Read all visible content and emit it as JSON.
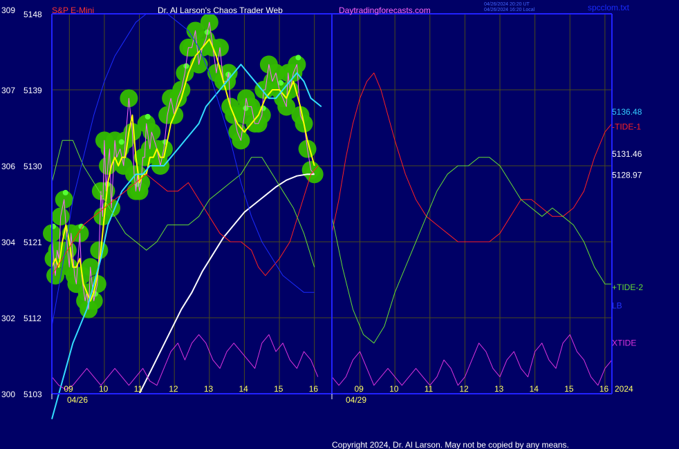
{
  "header": {
    "instrument": "S&P E-Mini",
    "site": "Dr. Al Larson's Chaos Trader Web",
    "url": "Daytradingforecasts.com",
    "utc_stamp": "04/26/2024 20:20 UT",
    "local_stamp": "04/26/2024 16:20 Local",
    "file": "spcclom.txt"
  },
  "footer": {
    "copyright": "Copyright 2024, Dr. Al Larson. May not be copied by any means."
  },
  "colors": {
    "background": "#000066",
    "axis": "#2222ff",
    "grid": "#4a4a1e",
    "price": "#ff66ff",
    "price_avg": "#ffff00",
    "ma": "#33ddff",
    "white_curve": "#ffffff",
    "tide1": "#ff2020",
    "tide2": "#66dd33",
    "lb": "#1a2bff",
    "xtide": "#dd33dd",
    "balls": "#33bb00",
    "header_text": "#ff66ff",
    "instrument_text": "#ff3333"
  },
  "chart_data": {
    "type": "line",
    "title": "S&P E-Mini",
    "y_left_outer_ticks": [
      "309",
      "307",
      "306",
      "304",
      "302",
      "300"
    ],
    "y_price_ticks": [
      5148,
      5139,
      5130,
      5121,
      5112,
      5103
    ],
    "ylim": [
      5103,
      5148
    ],
    "x_tick_labels_day1": [
      "09",
      "10",
      "11",
      "12",
      "13",
      "14",
      "15",
      "16"
    ],
    "x_tick_labels_day2": [
      "09",
      "10",
      "11",
      "12",
      "13",
      "14",
      "15",
      "16"
    ],
    "x_ticks_hour": [
      9,
      10,
      11,
      12,
      13,
      14,
      15,
      16
    ],
    "date_labels": [
      "04/26",
      "04/29"
    ],
    "year_label": "2024",
    "hours_day1": [
      8.5,
      16.5
    ],
    "hours_day2": [
      8.2,
      16.2
    ],
    "right_labels": [
      {
        "text": "5136.48",
        "color": "#33ccff",
        "price": 5136.48
      },
      {
        "text": "-TIDE-1",
        "color": "#ff2020",
        "price": 5134.7
      },
      {
        "text": "5131.46",
        "color": "#ffffff",
        "price": 5131.46
      },
      {
        "text": "5128.97",
        "color": "#ffffff",
        "price": 5128.97
      },
      {
        "text": "+TIDE-2",
        "color": "#66dd33",
        "price": 5115.7
      },
      {
        "text": "LB",
        "color": "#2233ff",
        "price": 5113.5
      },
      {
        "text": "XTIDE",
        "color": "#dd33dd",
        "price": 5109.1
      }
    ],
    "series": [
      {
        "name": "S&P E-Mini",
        "color": "#ff66ff",
        "day": 1,
        "x": [
          8.5,
          8.55,
          8.6,
          8.65,
          8.7,
          8.75,
          8.85,
          8.95,
          9.0,
          9.05,
          9.15,
          9.2,
          9.3,
          9.35,
          9.45,
          9.5,
          9.55,
          9.6,
          9.7,
          9.8,
          9.85,
          9.9,
          9.95,
          10.0,
          10.05,
          10.1,
          10.15,
          10.2,
          10.3,
          10.35,
          10.45,
          10.55,
          10.6,
          10.7,
          10.8,
          10.85,
          10.9,
          10.95,
          11.0,
          11.05,
          11.1,
          11.15,
          11.2,
          11.3,
          11.35,
          11.5,
          11.55,
          11.6,
          11.7,
          11.8,
          11.9,
          12.0,
          12.1,
          12.2,
          12.3,
          12.4,
          12.5,
          12.6,
          12.7,
          12.8,
          12.9,
          13.0,
          13.1,
          13.2,
          13.3,
          13.4,
          13.5,
          13.55,
          13.6,
          13.7,
          13.8,
          13.9,
          14.0,
          14.05,
          14.1,
          14.2,
          14.3,
          14.4,
          14.5,
          14.55,
          14.6,
          14.7,
          14.8,
          14.9,
          15.0,
          15.1,
          15.2,
          15.25,
          15.3,
          15.4,
          15.5,
          15.6,
          15.7,
          15.8,
          15.9,
          16.0
        ],
        "y": [
          5122,
          5119,
          5117,
          5120,
          5119,
          5124,
          5126,
          5120,
          5118,
          5122,
          5117,
          5116,
          5122,
          5117,
          5114,
          5115,
          5113,
          5118,
          5114,
          5116,
          5120,
          5127,
          5124,
          5133,
          5127,
          5130,
          5132,
          5125,
          5133,
          5131,
          5132,
          5130,
          5133,
          5138,
          5134,
          5129,
          5127,
          5129,
          5127,
          5128,
          5131,
          5131,
          5135,
          5132,
          5134,
          5132,
          5131,
          5130,
          5132,
          5136,
          5138,
          5136,
          5138,
          5139,
          5141,
          5144,
          5144,
          5146,
          5142,
          5144,
          5145,
          5147,
          5144,
          5141,
          5144,
          5140,
          5140,
          5141,
          5137,
          5136,
          5134,
          5133,
          5136,
          5138,
          5137,
          5137,
          5135,
          5135,
          5136,
          5139,
          5139,
          5142,
          5140,
          5141,
          5139,
          5138,
          5137,
          5141,
          5139,
          5141,
          5142,
          5136,
          5135,
          5132,
          5129.5,
          5129
        ]
      },
      {
        "name": "",
        "color": "#ffff00",
        "day": 1,
        "x": [
          8.5,
          8.6,
          8.7,
          8.8,
          8.9,
          9.0,
          9.1,
          9.2,
          9.3,
          9.4,
          9.5,
          9.6,
          9.7,
          9.8,
          9.9,
          10.0,
          10.1,
          10.2,
          10.3,
          10.4,
          10.5,
          10.6,
          10.7,
          10.8,
          10.9,
          11.0,
          11.1,
          11.2,
          11.3,
          11.4,
          11.5,
          11.6,
          11.7,
          11.8,
          11.9,
          12.0,
          12.2,
          12.4,
          12.6,
          12.8,
          13.0,
          13.2,
          13.4,
          13.6,
          13.8,
          14.0,
          14.2,
          14.4,
          14.6,
          14.8,
          15.0,
          15.2,
          15.4,
          15.6,
          15.8,
          16.0
        ],
        "y": [
          5118,
          5119,
          5118,
          5121,
          5123,
          5121,
          5118,
          5118,
          5119,
          5116,
          5115,
          5114,
          5115,
          5117,
          5120,
          5124,
          5128,
          5130,
          5131,
          5130,
          5131,
          5131,
          5134,
          5136,
          5131,
          5128,
          5129,
          5129,
          5131,
          5131,
          5132,
          5131,
          5131,
          5133,
          5135,
          5136,
          5138,
          5141,
          5143,
          5144,
          5145,
          5143,
          5140,
          5137,
          5135,
          5134,
          5135,
          5136,
          5138,
          5139,
          5139,
          5138,
          5140,
          5137,
          5133,
          5130
        ]
      },
      {
        "name": "",
        "color": "#33ddff",
        "day": 1,
        "x": [
          8.5,
          8.7,
          8.9,
          9.1,
          9.3,
          9.5,
          9.7,
          9.9,
          10.1,
          10.3,
          10.5,
          10.7,
          10.9,
          11.1,
          11.3,
          11.5,
          11.7,
          11.9,
          12.1,
          12.3,
          12.5,
          12.7,
          12.9,
          13.1,
          13.3,
          13.5,
          13.7,
          13.9,
          14.1,
          14.3,
          14.5,
          14.7,
          14.9,
          15.1,
          15.3,
          15.5,
          15.7,
          15.9,
          16.2
        ],
        "y": [
          5100,
          5103,
          5106,
          5109,
          5111,
          5113,
          5116,
          5119,
          5123,
          5125,
          5127,
          5128,
          5129,
          5129,
          5130,
          5130,
          5130,
          5131,
          5132,
          5133,
          5134,
          5135,
          5137,
          5138,
          5139,
          5140,
          5141,
          5142,
          5141,
          5140,
          5139,
          5138,
          5138,
          5139,
          5140,
          5141,
          5140,
          5138,
          5137
        ]
      },
      {
        "name": "",
        "color": "#ffffff",
        "day": 1,
        "x": [
          11.0,
          11.3,
          11.6,
          11.9,
          12.2,
          12.5,
          12.8,
          13.1,
          13.4,
          13.7,
          14.0,
          14.3,
          14.6,
          14.9,
          15.2,
          15.5,
          15.8,
          16.0
        ],
        "y": [
          5103,
          5105.5,
          5108,
          5110.5,
          5113,
          5115,
          5117.5,
          5119.5,
          5121.5,
          5123,
          5124.5,
          5125.5,
          5126.5,
          5127.5,
          5128.3,
          5128.8,
          5129,
          5129
        ]
      },
      {
        "name": "-TIDE-1",
        "color": "#ff2020",
        "day": 1,
        "x": [
          8.5,
          8.8,
          9.1,
          9.4,
          9.7,
          10.0,
          10.3,
          10.6,
          10.9,
          11.2,
          11.5,
          11.8,
          12.1,
          12.4,
          12.7,
          13.0,
          13.3,
          13.6,
          13.9,
          14.2,
          14.4,
          14.6,
          14.8,
          15.0,
          15.3,
          15.6,
          15.9,
          16.1
        ],
        "y": [
          5117,
          5119,
          5121,
          5123,
          5124,
          5125,
          5126,
          5127,
          5128,
          5129,
          5128,
          5127,
          5127,
          5128,
          5126,
          5124,
          5122,
          5121,
          5121,
          5120,
          5118,
          5117,
          5118,
          5119,
          5121,
          5125,
          5129,
          5130
        ]
      },
      {
        "name": "-TIDE-1",
        "color": "#ff2020",
        "day": 2,
        "x": [
          8.2,
          8.4,
          8.6,
          8.8,
          9.0,
          9.2,
          9.4,
          9.6,
          9.8,
          10.0,
          10.3,
          10.6,
          10.9,
          11.2,
          11.5,
          11.8,
          12.1,
          12.4,
          12.7,
          13.0,
          13.3,
          13.6,
          13.9,
          14.2,
          14.5,
          14.8,
          15.1,
          15.4,
          15.7,
          16.0,
          16.2
        ],
        "y": [
          5122,
          5126,
          5131,
          5135,
          5138,
          5140,
          5141,
          5139,
          5136,
          5133,
          5129,
          5126,
          5124,
          5123,
          5122,
          5121,
          5121,
          5121,
          5121,
          5122,
          5124,
          5126,
          5126,
          5125,
          5124,
          5124,
          5125,
          5127,
          5131,
          5134,
          5135
        ]
      },
      {
        "name": "+TIDE-2",
        "color": "#66dd33",
        "day": 1,
        "x": [
          8.5,
          8.8,
          9.1,
          9.4,
          9.7,
          10.0,
          10.3,
          10.6,
          10.9,
          11.2,
          11.5,
          11.8,
          12.1,
          12.4,
          12.7,
          13.0,
          13.3,
          13.6,
          13.9,
          14.2,
          14.5,
          14.8,
          15.1,
          15.4,
          15.7,
          16.0
        ],
        "y": [
          5128,
          5133,
          5133,
          5130,
          5128,
          5126,
          5124,
          5122,
          5121,
          5120,
          5121,
          5123,
          5123,
          5123,
          5124,
          5126,
          5127,
          5128,
          5129,
          5131,
          5131,
          5129,
          5127,
          5125,
          5122,
          5118
        ]
      },
      {
        "name": "+TIDE-2",
        "color": "#66dd33",
        "day": 2,
        "x": [
          8.2,
          8.5,
          8.8,
          9.1,
          9.4,
          9.7,
          10.0,
          10.3,
          10.6,
          10.9,
          11.2,
          11.5,
          11.8,
          12.1,
          12.4,
          12.7,
          13.0,
          13.3,
          13.6,
          13.9,
          14.2,
          14.5,
          14.8,
          15.1,
          15.4,
          15.7,
          16.0,
          16.2
        ],
        "y": [
          5124,
          5118,
          5113,
          5110,
          5109,
          5111,
          5115,
          5118,
          5121,
          5124,
          5127,
          5129,
          5130,
          5130,
          5131,
          5131,
          5130,
          5128,
          5126,
          5125,
          5124,
          5125,
          5124,
          5123,
          5121,
          5118,
          5116,
          5116
        ]
      },
      {
        "name": "LB",
        "color": "#1a2bff",
        "day": 1,
        "x": [
          8.5,
          8.8,
          9.1,
          9.4,
          9.7,
          10.0,
          10.3,
          10.6,
          10.9,
          11.2,
          11.5,
          11.8,
          12.1,
          12.4,
          12.7,
          13.0,
          13.3,
          13.6,
          13.9,
          14.2,
          14.5,
          14.8,
          15.1,
          15.4,
          15.7,
          16.0
        ],
        "y": [
          5111,
          5118,
          5126,
          5131,
          5136,
          5140,
          5143,
          5145,
          5147,
          5148,
          5148,
          5148,
          5147,
          5146,
          5144,
          5141,
          5137,
          5133,
          5128,
          5124,
          5121,
          5119,
          5117,
          5116,
          5115,
          5115
        ]
      },
      {
        "name": "XTIDE",
        "color": "#dd33dd",
        "day": 1,
        "x": [
          8.5,
          8.7,
          8.9,
          9.1,
          9.3,
          9.5,
          9.7,
          9.9,
          10.1,
          10.3,
          10.5,
          10.7,
          10.9,
          11.1,
          11.3,
          11.5,
          11.7,
          11.9,
          12.1,
          12.3,
          12.5,
          12.7,
          12.9,
          13.1,
          13.3,
          13.5,
          13.7,
          13.9,
          14.1,
          14.3,
          14.5,
          14.7,
          14.9,
          15.1,
          15.3,
          15.5,
          15.7,
          15.9,
          16.1
        ],
        "y": [
          5105,
          5104,
          5103.5,
          5104,
          5105,
          5106,
          5105,
          5104,
          5105,
          5106,
          5105,
          5104,
          5105,
          5106,
          5104.5,
          5104,
          5106,
          5108,
          5109,
          5107,
          5109,
          5110,
          5109,
          5107,
          5106,
          5108,
          5109,
          5108,
          5107,
          5106,
          5109,
          5110,
          5108,
          5109,
          5107,
          5106,
          5108,
          5107,
          5105
        ]
      },
      {
        "name": "XTIDE",
        "color": "#dd33dd",
        "day": 2,
        "x": [
          8.2,
          8.4,
          8.6,
          8.8,
          9.0,
          9.2,
          9.4,
          9.6,
          9.8,
          10.0,
          10.2,
          10.4,
          10.6,
          10.8,
          11.0,
          11.2,
          11.4,
          11.6,
          11.8,
          12.0,
          12.2,
          12.4,
          12.6,
          12.8,
          13.0,
          13.2,
          13.4,
          13.6,
          13.8,
          14.0,
          14.2,
          14.4,
          14.6,
          14.8,
          15.0,
          15.2,
          15.4,
          15.6,
          15.8,
          16.0,
          16.2
        ],
        "y": [
          5105,
          5104,
          5105,
          5107,
          5108,
          5106,
          5104,
          5105,
          5106,
          5105,
          5104,
          5105,
          5106,
          5105,
          5104,
          5105,
          5107,
          5106,
          5104,
          5105,
          5107,
          5109,
          5108,
          5106,
          5105,
          5107,
          5108,
          5106,
          5105,
          5108,
          5109,
          5107,
          5106,
          5109,
          5110,
          5108,
          5107,
          5105,
          5104,
          5106,
          5107
        ]
      }
    ]
  }
}
